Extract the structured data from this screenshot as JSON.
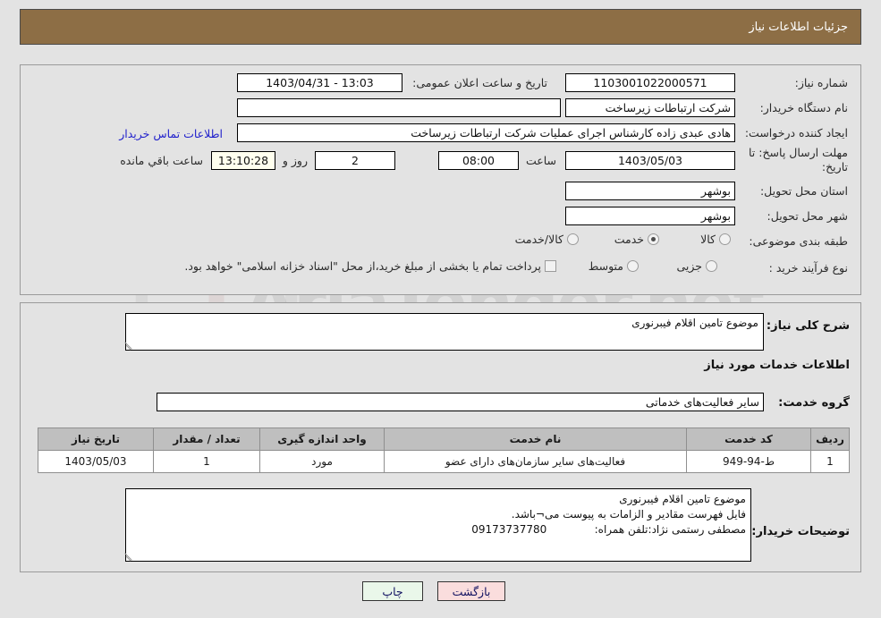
{
  "header": {
    "title": "جزئیات اطلاعات نیاز"
  },
  "fields": {
    "need_number_label": "شماره نیاز:",
    "need_number_value": "1103001022000571",
    "public_announce_label": "تاریخ و ساعت اعلان عمومی:",
    "public_announce_value": "13:03 - 1403/04/31",
    "buyer_org_label": "نام دستگاه خریدار:",
    "buyer_org_value": "شرکت ارتباطات زیرساخت",
    "buyer_org_value2": "شرکت ارتباطات زیرساخت",
    "requester_label": "ایجاد کننده درخواست:",
    "requester_value": "هادی عبدی زاده کارشناس اجرای عملیات شرکت ارتباطات زیرساخت",
    "contact_link": "اطلاعات تماس خریدار",
    "deadline_label": "مهلت ارسال پاسخ: تا تاریخ:",
    "deadline_date": "1403/05/03",
    "hour_label": "ساعت",
    "deadline_time": "08:00",
    "days_value": "2",
    "days_label": "روز و",
    "countdown_value": "13:10:28",
    "remaining_label": "ساعت باقي مانده",
    "province_label": "استان محل تحویل:",
    "province_value": "بوشهر",
    "city_label": "شهر محل تحویل:",
    "city_value": "بوشهر",
    "category_label": "طبقه بندی موضوعی:",
    "process_label": "نوع فرآیند خرید :",
    "treasury_note": "پرداخت تمام یا بخشی از مبلغ خرید،از محل \"اسناد خزانه اسلامی\" خواهد بود."
  },
  "category_options": [
    {
      "label": "کالا",
      "selected": false
    },
    {
      "label": "خدمت",
      "selected": true
    },
    {
      "label": "کالا/خدمت",
      "selected": false
    }
  ],
  "process_options": [
    {
      "label": "جزیی",
      "selected": false
    },
    {
      "label": "متوسط",
      "selected": false
    }
  ],
  "treasury_checkbox": {
    "checked": false
  },
  "description": {
    "label": "شرح کلی نیاز:",
    "value": "موضوع تامین اقلام فیبرنوری"
  },
  "services_section": {
    "heading": "اطلاعات خدمات مورد نیاز",
    "group_label": "گروه خدمت:",
    "group_value": "سایر فعالیت‌های خدماتی"
  },
  "table": {
    "columns": [
      "ردیف",
      "کد خدمت",
      "نام خدمت",
      "واحد اندازه گیری",
      "تعداد / مقدار",
      "تاریخ نیاز"
    ],
    "rows": [
      {
        "row": "1",
        "code": "ط-94-949",
        "name": "فعالیت‌های سایر سازمان‌های دارای عضو",
        "unit": "مورد",
        "qty": "1",
        "date": "1403/05/03"
      }
    ]
  },
  "buyer_notes": {
    "label": "توضیحات خریدار:",
    "value": "موضوع تامین اقلام فیبرنوری\nفایل فهرست مقادیر و الزامات به پیوست می¬باشد.\nمصطفی رستمی نژاد:تلفن همراه:              09173737780"
  },
  "buttons": {
    "print": "چاپ",
    "back": "بازگشت"
  },
  "watermark": {
    "text": "AriaTender.net",
    "text_left": "AriaTender",
    "text_right": ".net"
  },
  "colors": {
    "header_bg": "#8d6e45",
    "page_bg": "#e3e3e3",
    "link": "#2222cc",
    "table_header_bg": "#bfbfbf",
    "print_btn_bg": "#eaf7ea",
    "back_btn_bg": "#fadddd",
    "countdown_bg": "#ffffee"
  }
}
